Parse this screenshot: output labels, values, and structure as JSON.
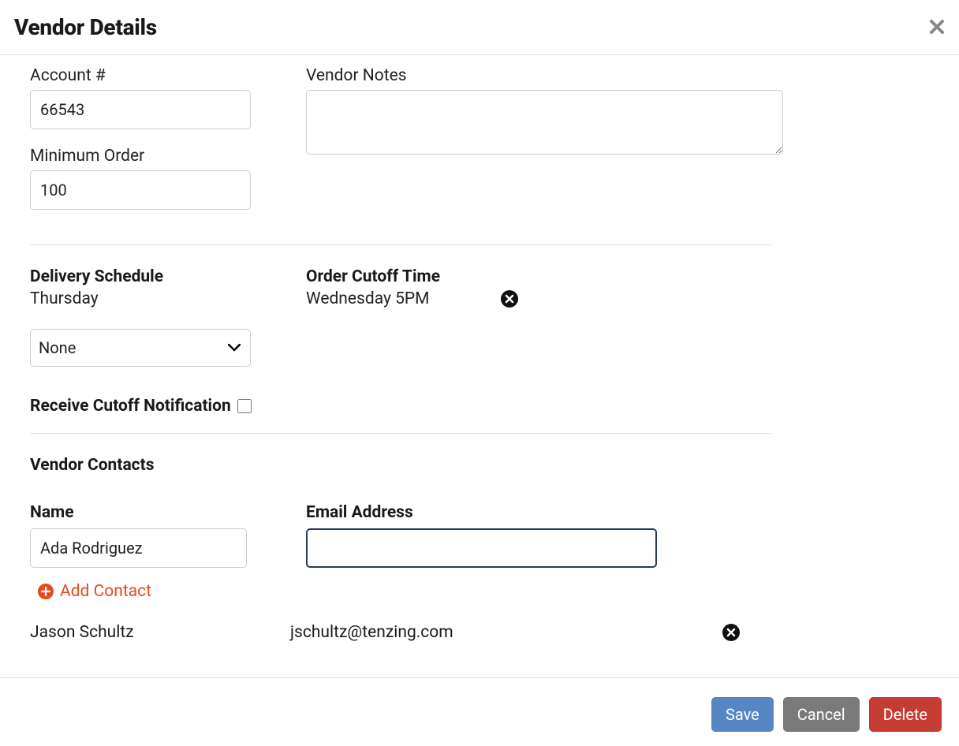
{
  "header": {
    "title": "Vendor Details"
  },
  "fields": {
    "account_label": "Account #",
    "account_value": "66543",
    "minorder_label": "Minimum Order",
    "minorder_value": "100",
    "notes_label": "Vendor Notes",
    "notes_value": ""
  },
  "schedule": {
    "delivery_heading": "Delivery Schedule",
    "delivery_day": "Thursday",
    "schedule_select": "None",
    "cutoff_heading": "Order Cutoff Time",
    "cutoff_value": "Wednesday 5PM",
    "notif_label": "Receive Cutoff Notification"
  },
  "contacts": {
    "heading": "Vendor Contacts",
    "name_label": "Name",
    "email_label": "Email Address",
    "new_name": "Ada Rodriguez",
    "new_email": "",
    "add_link": "Add Contact",
    "existing": {
      "name": "Jason Schultz",
      "email": "jschultz@tenzing.com"
    }
  },
  "footer": {
    "save": "Save",
    "cancel": "Cancel",
    "delete": "Delete"
  }
}
